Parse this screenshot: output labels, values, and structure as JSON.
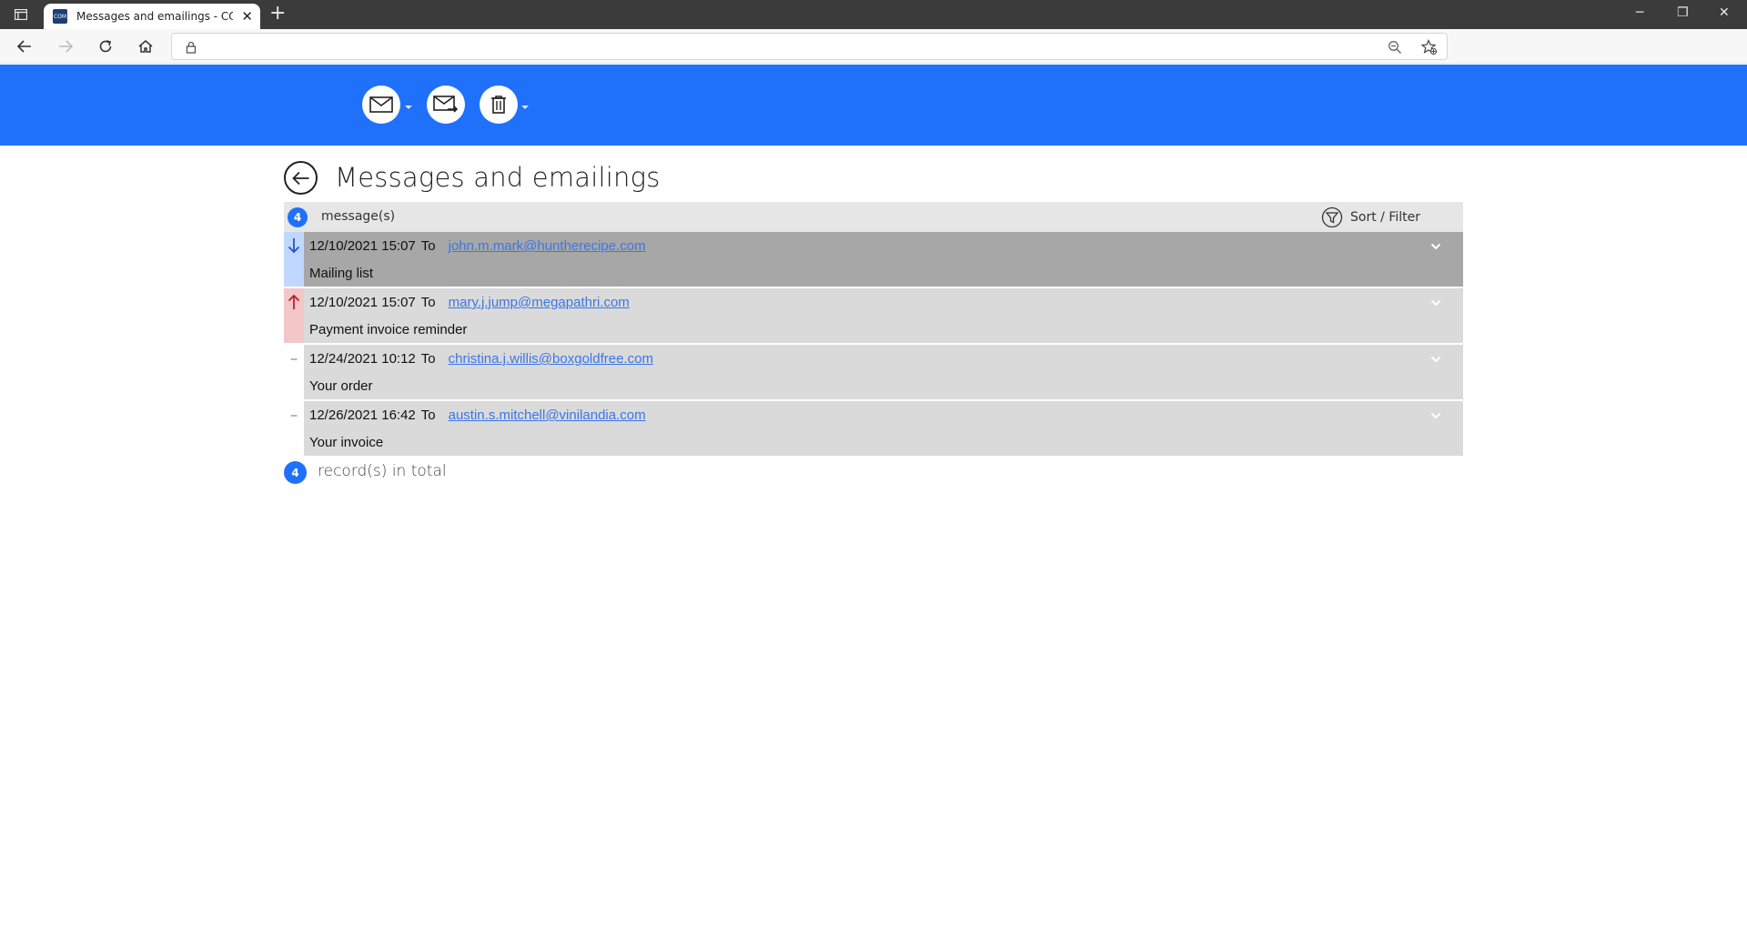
{
  "browser": {
    "tab_title": "Messages and emailings - COM-",
    "tab_favicon_text": "COM",
    "new_tab_symbol": "+",
    "address_value": ""
  },
  "icons": {
    "window": "window-menu-icon",
    "back": "arrow-left-icon",
    "forward": "arrow-right-icon",
    "reload": "reload-icon",
    "home": "home-icon",
    "lock": "lock-icon",
    "zoom": "zoom-out-icon",
    "favorites": "favorites-star-icon",
    "new_message": "envelope-icon",
    "forward_message": "envelope-forward-icon",
    "delete": "trash-icon",
    "filter": "filter-funnel-icon",
    "expand": "chevron-down-icon"
  },
  "colors": {
    "brand_blue": "#1f71fb",
    "row_bg": "#dadada",
    "row_selected_bg": "#a7a7a7",
    "incoming_marker": "#c0d8ff",
    "outgoing_marker": "#f3c6c8",
    "link": "#3a76e8"
  },
  "page": {
    "title": "Messages and emailings"
  },
  "list_header": {
    "count": "4",
    "count_label": "message(s)",
    "sort_filter_label": "Sort / Filter"
  },
  "messages": [
    {
      "direction": "incoming",
      "date": "12/10/2021 15:07",
      "to_label": "To",
      "email": "john.m.mark@huntherecipe.com",
      "subject": "Mailing list",
      "selected": true
    },
    {
      "direction": "outgoing",
      "date": "12/10/2021 15:07",
      "to_label": "To",
      "email": "mary.j.jump@megapathri.com",
      "subject": "Payment invoice reminder",
      "selected": false
    },
    {
      "direction": "none",
      "date": "12/24/2021 10:12",
      "to_label": "To",
      "email": "christina.j.willis@boxgoldfree.com",
      "subject": "Your order",
      "selected": false
    },
    {
      "direction": "none",
      "date": "12/26/2021 16:42",
      "to_label": "To",
      "email": "austin.s.mitchell@vinilandia.com",
      "subject": "Your invoice",
      "selected": false
    }
  ],
  "footer": {
    "count": "4",
    "label": "record(s) in total"
  }
}
